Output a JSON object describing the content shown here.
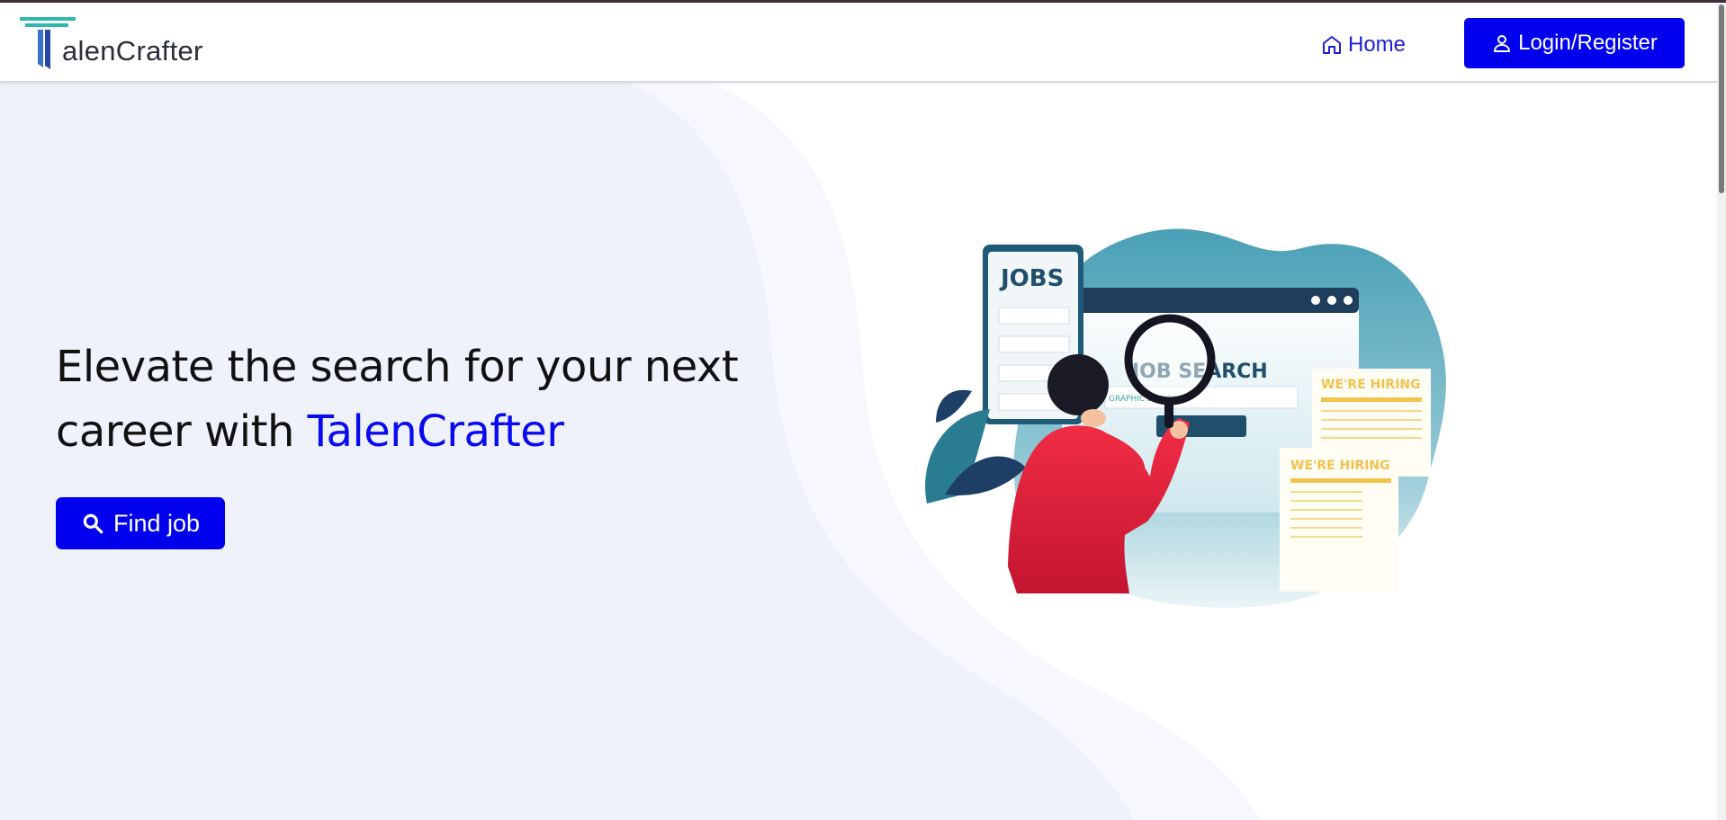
{
  "brand": {
    "logo_initial": "T",
    "logo_rest": "alenCrafter"
  },
  "nav": {
    "home_label": "Home",
    "login_label": "Login/Register"
  },
  "hero": {
    "title_line1": "Elevate the search for your next",
    "title_line2_prefix": "career with ",
    "title_brand": "TalenCrafter",
    "find_button_label": "Find job"
  },
  "illustration": {
    "jobs_label": "JOBS",
    "search_label": "JOB SEARCH",
    "search_field_text": "GRAPHIC DESIGNER",
    "hiring_label_1": "WE'RE HIRING",
    "hiring_label_2": "WE'RE HIRING"
  },
  "colors": {
    "accent": "#0000ee",
    "brand_text": "#0a0af0",
    "hero_bg": "#eef1fa",
    "illustration_teal": "#4ea3b8",
    "shirt_red": "#e8213a",
    "hiring_yellow": "#f3c24f"
  },
  "icons": {
    "logo": "talencrafter-logo-icon",
    "home": "home-icon",
    "user": "user-icon",
    "search": "search-icon"
  }
}
